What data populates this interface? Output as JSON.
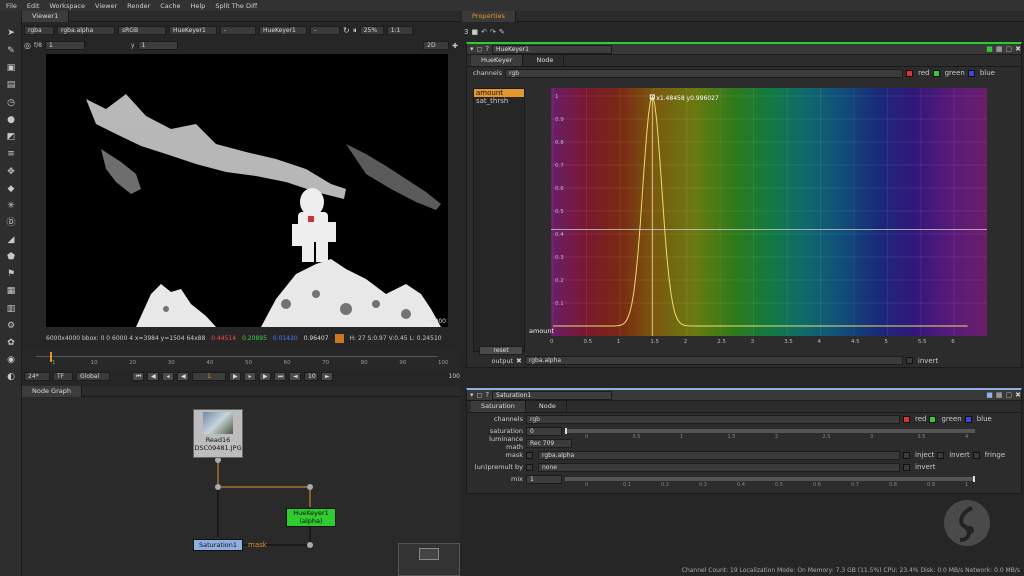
{
  "menu": [
    "File",
    "Edit",
    "Workspace",
    "Viewer",
    "Render",
    "Cache",
    "Help",
    "Split The Diff"
  ],
  "viewer": {
    "tab": "Viewer1",
    "channel": "rgba",
    "alpha": "rgba.alpha",
    "colorspace": "sRGB",
    "input_a": "HueKeyer1",
    "input_a2": "-",
    "input_b": "HueKeyer1",
    "input_b2": "-",
    "zoom": "25%",
    "ratio": "1:1",
    "mode": "2D",
    "fstop": "f/8",
    "frame_field": "1",
    "y_label": "y",
    "y_field": "1",
    "resolution": "6000x4000",
    "corner_label": "6000",
    "status": {
      "bbox": "6000x4000  bbox: 0 0 6000 4  x=3984 y=1504 64x88",
      "r": "0.44514",
      "g": "0.20895",
      "b": "0.01420",
      "a": "0.96407",
      "hsvl": "H: 27 S:0.97 V:0.45  L: 0.24510"
    },
    "timeline": {
      "start": "1",
      "end": "100",
      "labels": [
        "1",
        "10",
        "20",
        "30",
        "40",
        "50",
        "60",
        "70",
        "80",
        "90",
        "100"
      ],
      "fps": "24*",
      "tf": "TF",
      "global": "Global",
      "frame": "1",
      "step": "10",
      "end_field": "100"
    }
  },
  "nodegraph": {
    "tab": "Node Graph",
    "read_node": {
      "name": "Read16",
      "file": "DSC09481.JPG"
    },
    "huekeyer_node": {
      "name": "HueKeyer1",
      "sub": "(alpha)"
    },
    "saturation_node": {
      "name": "Saturation1"
    },
    "mask_label": "mask"
  },
  "properties": {
    "tab": "Properties",
    "count": "3",
    "huekeyer": {
      "title": "HueKeyer1",
      "tabs": [
        "HueKeyer",
        "Node"
      ],
      "channels_label": "channels",
      "channels_value": "rgb",
      "red": "red",
      "green": "green",
      "blue": "blue",
      "curves": [
        "amount",
        "sat_thrsh"
      ],
      "reset": "reset",
      "readout": "x1.48458  y0.996027",
      "curve_label": "amount",
      "y_ticks": [
        "1",
        "0.9",
        "0.8",
        "0.7",
        "0.6",
        "0.5",
        "0.4",
        "0.3",
        "0.2",
        "0.1"
      ],
      "x_ticks": [
        "0",
        "0.5",
        "1",
        "1.5",
        "2",
        "2.5",
        "3",
        "3.5",
        "4",
        "4.5",
        "5",
        "5.5",
        "6"
      ],
      "output_label": "output",
      "output_value": "rgba.alpha",
      "invert": "invert"
    },
    "saturation": {
      "title": "Saturation1",
      "tabs": [
        "Saturation",
        "Node"
      ],
      "channels_label": "channels",
      "channels_value": "rgb",
      "red": "red",
      "green": "green",
      "blue": "blue",
      "saturation_label": "saturation",
      "saturation_value": "0",
      "luminance_label": "luminance math",
      "luminance_value": "Rec 709",
      "mask_label": "mask",
      "mask_value": "rgba.alpha",
      "inject": "inject",
      "invert": "invert",
      "fringe": "fringe",
      "premult_label": "(un)premult by",
      "premult_value": "none",
      "premult_invert": "invert",
      "mix_label": "mix",
      "mix_value": "1",
      "sat_ticks": [
        "0",
        "0.5",
        "1",
        "1.5",
        "2",
        "2.5",
        "3",
        "3.5",
        "4"
      ],
      "mix_ticks": [
        "0",
        "0.1",
        "0.2",
        "0.3",
        "0.4",
        "0.5",
        "0.6",
        "0.7",
        "0.8",
        "0.9",
        "1"
      ]
    }
  },
  "statusbar": "Channel Count: 19  Localization Mode: On  Memory: 7.3 GB (11.5%)  CPU: 23.4%  Disk: 0.0 MB/s  Network: 0.0 MB/s",
  "colors": {
    "accent": "#e3952e",
    "keyer_green": "#2ecc2e",
    "sat_blue": "#8fb0e0",
    "panel": "#2c2c2c"
  }
}
